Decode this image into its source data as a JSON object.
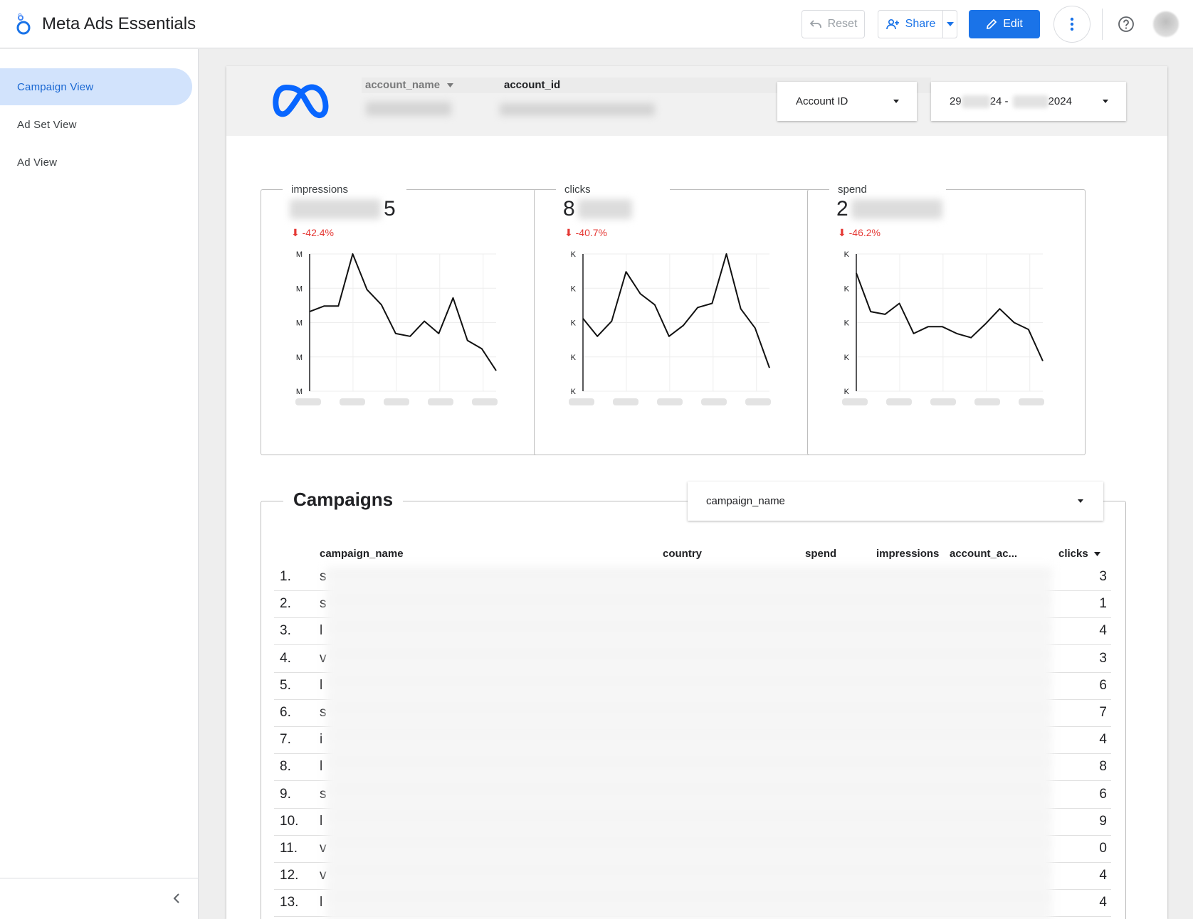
{
  "app": {
    "title": "Meta Ads Essentials",
    "reset_label": "Reset",
    "share_label": "Share",
    "edit_label": "Edit"
  },
  "sidebar": {
    "items": [
      {
        "label": "Campaign View",
        "active": true
      },
      {
        "label": "Ad Set View",
        "active": false
      },
      {
        "label": "Ad View",
        "active": false
      }
    ]
  },
  "header": {
    "account_name_label": "account_name",
    "account_id_label": "account_id",
    "account_id_control": "Account ID",
    "date_start": "29",
    "date_mid": "24 -",
    "date_end": "2024"
  },
  "scorecards": [
    {
      "label": "impressions",
      "value_visible": "5",
      "delta": "-42.4%"
    },
    {
      "label": "clicks",
      "value_visible": "8",
      "delta": "-40.7%"
    },
    {
      "label": "spend",
      "value_visible": "2",
      "delta": "-46.2%"
    }
  ],
  "chart_data": [
    {
      "type": "line",
      "series": [
        {
          "values": [
            0.58,
            0.62,
            0.62,
            1.0,
            0.74,
            0.63,
            0.42,
            0.4,
            0.51,
            0.42,
            0.68,
            0.37,
            0.31,
            0.15
          ]
        }
      ],
      "y_tick_suffix": "M",
      "ylim": [
        0,
        1
      ]
    },
    {
      "type": "line",
      "series": [
        {
          "values": [
            0.53,
            0.4,
            0.51,
            0.87,
            0.71,
            0.63,
            0.4,
            0.48,
            0.61,
            0.64,
            1.0,
            0.6,
            0.46,
            0.17
          ]
        }
      ],
      "y_tick_suffix": "K",
      "ylim": [
        0,
        1
      ]
    },
    {
      "type": "line",
      "series": [
        {
          "values": [
            0.86,
            0.58,
            0.56,
            0.64,
            0.42,
            0.47,
            0.47,
            0.42,
            0.39,
            0.49,
            0.6,
            0.5,
            0.45,
            0.22
          ]
        }
      ],
      "y_tick_suffix": "K",
      "ylim": [
        0,
        1
      ]
    }
  ],
  "campaigns": {
    "title": "Campaigns",
    "filter_label": "campaign_name",
    "columns": [
      "campaign_name",
      "country",
      "spend",
      "impressions",
      "account_ac...",
      "clicks"
    ],
    "rows": [
      {
        "idx": "1.",
        "first": "s",
        "last": "3"
      },
      {
        "idx": "2.",
        "first": "s",
        "last": "1"
      },
      {
        "idx": "3.",
        "first": "l",
        "last": "4"
      },
      {
        "idx": "4.",
        "first": "v",
        "last": "3"
      },
      {
        "idx": "5.",
        "first": "l",
        "last": "6"
      },
      {
        "idx": "6.",
        "first": "s",
        "last": "7"
      },
      {
        "idx": "7.",
        "first": "i",
        "last": "4"
      },
      {
        "idx": "8.",
        "first": "l",
        "last": "8"
      },
      {
        "idx": "9.",
        "first": "s",
        "last": "6"
      },
      {
        "idx": "10.",
        "first": "l",
        "last": "9"
      },
      {
        "idx": "11.",
        "first": "v",
        "last": "0"
      },
      {
        "idx": "12.",
        "first": "v",
        "last": "4"
      },
      {
        "idx": "13.",
        "first": "l",
        "last": "4"
      }
    ]
  },
  "colors": {
    "accent": "#1a73e8",
    "nav_active_bg": "#d2e3fc",
    "delta_negative": "#e53935"
  }
}
